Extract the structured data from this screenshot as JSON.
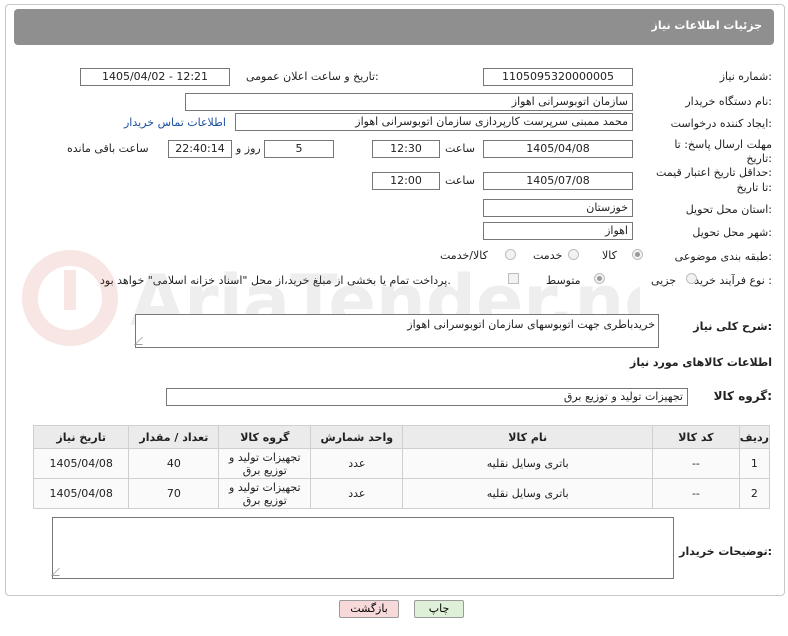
{
  "header": {
    "title": "جزئیات اطلاعات نیاز"
  },
  "fields": {
    "need_number": {
      "label": "شماره نیاز:",
      "value": "1105095320000005"
    },
    "announce_date": {
      "label": "تاریخ و ساعت اعلان عمومی:",
      "value": "1405/04/02 - 12:21"
    },
    "buyer_org": {
      "label": "نام دستگاه خریدار:",
      "value": "سازمان اتوبوسرانی اهواز"
    },
    "creator": {
      "label": "ایجاد کننده درخواست:",
      "value": "محمد ممبنی سرپرست کارپردازی سازمان اتوبوسرانی اهواز",
      "contact_link": "اطلاعات تماس خریدار"
    },
    "reply_deadline": {
      "label_line1": "مهلت ارسال پاسخ: تا",
      "label_line2": "تاریخ:",
      "date": "1405/04/08",
      "time_label": "ساعت",
      "time": "12:30",
      "days": "5",
      "days_label": "روز و",
      "remaining": "22:40:14",
      "remaining_label": "ساعت باقی مانده"
    },
    "price_validity": {
      "label_line1": "حداقل تاریخ اعتبار قیمت:",
      "label_line2": "تا تاریخ:",
      "date": "1405/07/08",
      "time_label": "ساعت",
      "time": "12:00"
    },
    "province": {
      "label": "استان محل تحویل:",
      "value": "خوزستان"
    },
    "city": {
      "label": "شهر محل تحویل:",
      "value": "اهواز"
    },
    "category": {
      "label": "طبقه بندی موضوعی:",
      "options": [
        "کالا",
        "خدمت",
        "کالا/خدمت"
      ],
      "selected": "کالا"
    },
    "purchase_type": {
      "label": "نوع فرآیند خرید :",
      "options": [
        "جزیی",
        "متوسط"
      ],
      "selected": "متوسط",
      "checkbox_text": "پرداخت تمام یا بخشی از مبلغ خرید،از محل \"اسناد خزانه اسلامی\" خواهد بود."
    }
  },
  "description": {
    "label": "شرح کلی نیاز:",
    "value": "خریدباطری جهت اتوبوسهای سازمان اتوبوسرانی اهواز"
  },
  "goods_section": {
    "title": "اطلاعات کالاهای مورد نیاز",
    "group_label": "گروه کالا:",
    "group_value": "تجهیزات تولید و توزیع برق"
  },
  "table": {
    "headers": [
      "ردیف",
      "کد کالا",
      "نام کالا",
      "واحد شمارش",
      "گروه کالا",
      "تعداد / مقدار",
      "تاریخ نیاز"
    ],
    "rows": [
      [
        "1",
        "--",
        "باتری وسایل نقلیه",
        "عدد",
        "تجهیزات تولید و توزیع برق",
        "40",
        "1405/04/08"
      ],
      [
        "2",
        "--",
        "باتری وسایل نقلیه",
        "عدد",
        "تجهیزات تولید و توزیع برق",
        "70",
        "1405/04/08"
      ]
    ]
  },
  "buyer_notes": {
    "label": "توضیحات خریدار:",
    "value": ""
  },
  "buttons": {
    "print": "چاپ",
    "back": "بازگشت"
  },
  "watermark": {
    "text": "AriaTender.net"
  },
  "colors": {
    "header_bg": "#8f8f8f",
    "link": "#1a4fa0",
    "back_button_bg": "#f7d9d9",
    "print_button_bg": "#dff0d8"
  }
}
